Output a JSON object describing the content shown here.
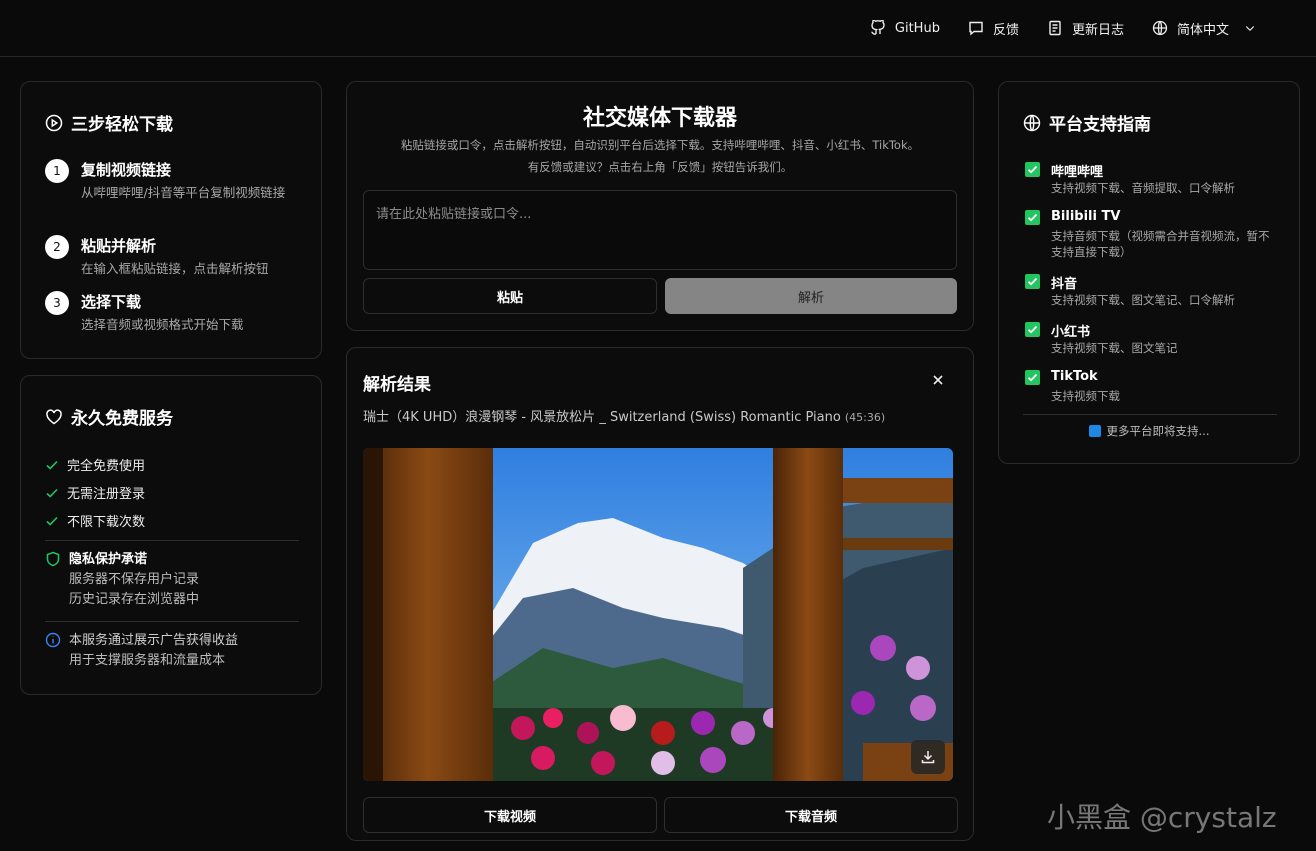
{
  "nav": {
    "github": "GitHub",
    "feedback": "反馈",
    "changelog": "更新日志",
    "language": "简体中文"
  },
  "steps": {
    "title": "三步轻松下载",
    "items": [
      {
        "num": "1",
        "title": "复制视频链接",
        "desc": "从哔哩哔哩/抖音等平台复制视频链接"
      },
      {
        "num": "2",
        "title": "粘贴并解析",
        "desc": "在输入框粘贴链接，点击解析按钮"
      },
      {
        "num": "3",
        "title": "选择下载",
        "desc": "选择音频或视频格式开始下载"
      }
    ]
  },
  "free": {
    "title": "永久免费服务",
    "checks": [
      "完全免费使用",
      "无需注册登录",
      "不限下载次数"
    ],
    "privacy": {
      "title": "隐私保护承诺",
      "line1": "服务器不保存用户记录",
      "line2": "历史记录存在浏览器中"
    },
    "ads": {
      "line1": "本服务通过展示广告获得收益",
      "line2": "用于支撑服务器和流量成本"
    }
  },
  "downloader": {
    "title": "社交媒体下载器",
    "desc1": "粘贴链接或口令，点击解析按钮，自动识别平台后选择下载。支持哔哩哔哩、抖音、小红书、TikTok。",
    "desc2": "有反馈或建议？点击右上角「反馈」按钮告诉我们。",
    "placeholder": "请在此处粘贴链接或口令...",
    "paste_label": "粘贴",
    "parse_label": "解析"
  },
  "result": {
    "title": "解析结果",
    "video_title": "瑞士（4K UHD）浪漫钢琴 - 风景放松片 _ Switzerland (Swiss) Romantic Piano",
    "duration": "(45:36)",
    "download_video": "下载视频",
    "download_audio": "下载音频"
  },
  "platforms": {
    "title": "平台支持指南",
    "items": [
      {
        "name": "哔哩哔哩",
        "desc": "支持视频下载、音频提取、口令解析"
      },
      {
        "name": "Bilibili TV",
        "desc": "支持音频下载（视频需合并音视频流，暂不支持直接下载）"
      },
      {
        "name": "抖音",
        "desc": "支持视频下载、图文笔记、口令解析"
      },
      {
        "name": "小红书",
        "desc": "支持视频下载、图文笔记"
      },
      {
        "name": "TikTok",
        "desc": "支持视频下载"
      }
    ],
    "more": "更多平台即将支持..."
  },
  "watermark": "小黑盒 @crystalz",
  "colors": {
    "accent_green": "#22c55e",
    "info_blue": "#3b82f6"
  }
}
